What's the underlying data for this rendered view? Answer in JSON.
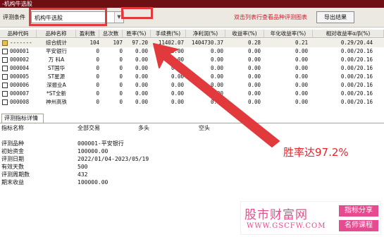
{
  "window": {
    "title": "-机构牛选股"
  },
  "toolbar": {
    "condition_label": "评测条件",
    "condition_value": "机构牛选股",
    "hint": "双击列表行查看品种评测图表",
    "export_label": "导出结果"
  },
  "table": {
    "columns": [
      "品种代码",
      "品种名称",
      "盈利数",
      "总次数",
      "胜率(%)",
      "手续费(%)",
      "净利润(%)",
      "收益率(%)",
      "年化收益率(%)",
      "相对收益率α/β(%)"
    ],
    "rows": [
      {
        "code": "-------",
        "name": "综合统计",
        "profit": "104",
        "total": "107",
        "win": "97.20",
        "fee": "11402.07",
        "net": "1404730.37",
        "ret": "0.28",
        "annual": "0.21",
        "rel": "0.29/20.44"
      },
      {
        "code": "000001",
        "name": "平安银行",
        "profit": "0",
        "total": "0",
        "win": "0.00",
        "fee": "0.00",
        "net": "0.00",
        "ret": "0.00",
        "annual": "0.00",
        "rel": "0.00/20.16"
      },
      {
        "code": "000002",
        "name": "万 科A",
        "profit": "0",
        "total": "0",
        "win": "0.00",
        "fee": "0.00",
        "net": "0.00",
        "ret": "0.00",
        "annual": "0.00",
        "rel": "0.00/20.16"
      },
      {
        "code": "000004",
        "name": "ST国华",
        "profit": "0",
        "total": "0",
        "win": "0.00",
        "fee": "0.00",
        "net": "0.00",
        "ret": "0.00",
        "annual": "0.00",
        "rel": "0.00/20.16"
      },
      {
        "code": "000005",
        "name": "ST星源",
        "profit": "0",
        "total": "0",
        "win": "0.00",
        "fee": "0.00",
        "net": "0.00",
        "ret": "0.00",
        "annual": "0.00",
        "rel": "0.00/20.16"
      },
      {
        "code": "000006",
        "name": "深振业A",
        "profit": "0",
        "total": "0",
        "win": "0.00",
        "fee": "0.00",
        "net": "0.00",
        "ret": "0.00",
        "annual": "0.00",
        "rel": "0.00/20.16"
      },
      {
        "code": "000007",
        "name": "*ST全新",
        "profit": "0",
        "total": "0",
        "win": "0.00",
        "fee": "0.00",
        "net": "0.00",
        "ret": "0.00",
        "annual": "0.00",
        "rel": "0.00/20.16"
      },
      {
        "code": "000008",
        "name": "神州高铁",
        "profit": "0",
        "total": "0",
        "win": "0.00",
        "fee": "0.00",
        "net": "0.00",
        "ret": "0.00",
        "annual": "0.00",
        "rel": "0.00/20.16"
      }
    ]
  },
  "detail": {
    "tab_label": "评测指标详情",
    "headers": [
      "指标名称",
      "全部交易",
      "多头",
      "空头"
    ],
    "items": [
      {
        "key": "评测品种",
        "value": "000001-平安银行"
      },
      {
        "key": "初始资金",
        "value": "100000.00"
      },
      {
        "key": "评测日期",
        "value": "2022/01/04-2023/05/19"
      },
      {
        "key": "有效天数",
        "value": "500"
      },
      {
        "key": "评测周期数",
        "value": "432"
      },
      {
        "key": "期末收益",
        "value": "100000.00"
      }
    ]
  },
  "annotation": {
    "text": "胜率达97.2%"
  },
  "watermark": {
    "title": "股市财富网",
    "url": "WWW.GSCFW.COM",
    "tag1": "指标分享",
    "tag2": "名师课程"
  },
  "colors": {
    "titlebar": "#6e0f14",
    "highlight_red": "#e23a3c",
    "hint_red": "#d21c2b",
    "watermark_pink": "#e74b8f"
  }
}
